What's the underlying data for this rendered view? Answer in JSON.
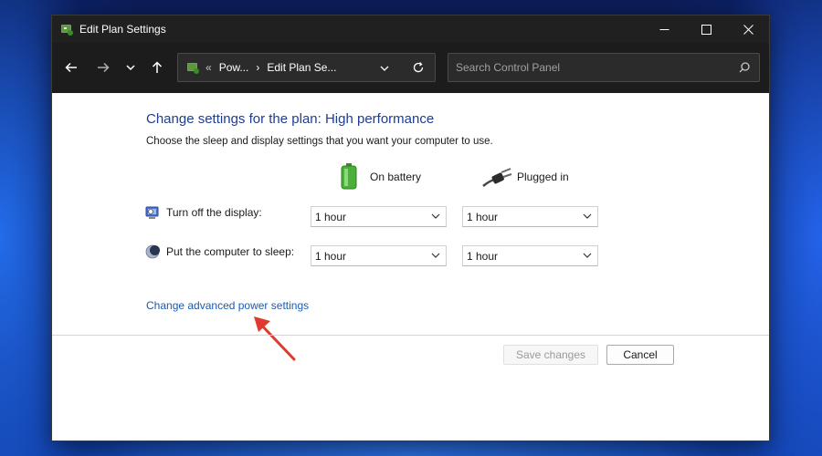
{
  "window": {
    "title": "Edit Plan Settings",
    "controls": {
      "minimize": "minimize-icon",
      "maximize": "maximize-icon",
      "close": "close-icon"
    }
  },
  "nav": {
    "back_icon": "arrow-left-icon",
    "forward_icon": "arrow-right-icon",
    "history_icon": "chevron-down-icon",
    "up_icon": "arrow-up-icon"
  },
  "address": {
    "separator": "«",
    "crumb1": "Pow...",
    "arrow": "›",
    "crumb2": "Edit Plan Se...",
    "dropdown_icon": "chevron-down-icon",
    "refresh_icon": "refresh-icon"
  },
  "search": {
    "placeholder": "Search Control Panel",
    "icon": "search-icon"
  },
  "main": {
    "heading": "Change settings for the plan: High performance",
    "subtext": "Choose the sleep and display settings that you want your computer to use.",
    "columns": {
      "battery": "On battery",
      "plugged": "Plugged in"
    },
    "rows": [
      {
        "label": "Turn off the display:",
        "battery_value": "1 hour",
        "plugged_value": "1 hour"
      },
      {
        "label": "Put the computer to sleep:",
        "battery_value": "1 hour",
        "plugged_value": "1 hour"
      }
    ],
    "advanced_link": "Change advanced power settings"
  },
  "footer": {
    "save_label": "Save changes",
    "cancel_label": "Cancel"
  },
  "colors": {
    "heading": "#1e3d8f",
    "link": "#1a5bb5",
    "arrow": "#e03a2e",
    "titlebar": "#202020"
  }
}
